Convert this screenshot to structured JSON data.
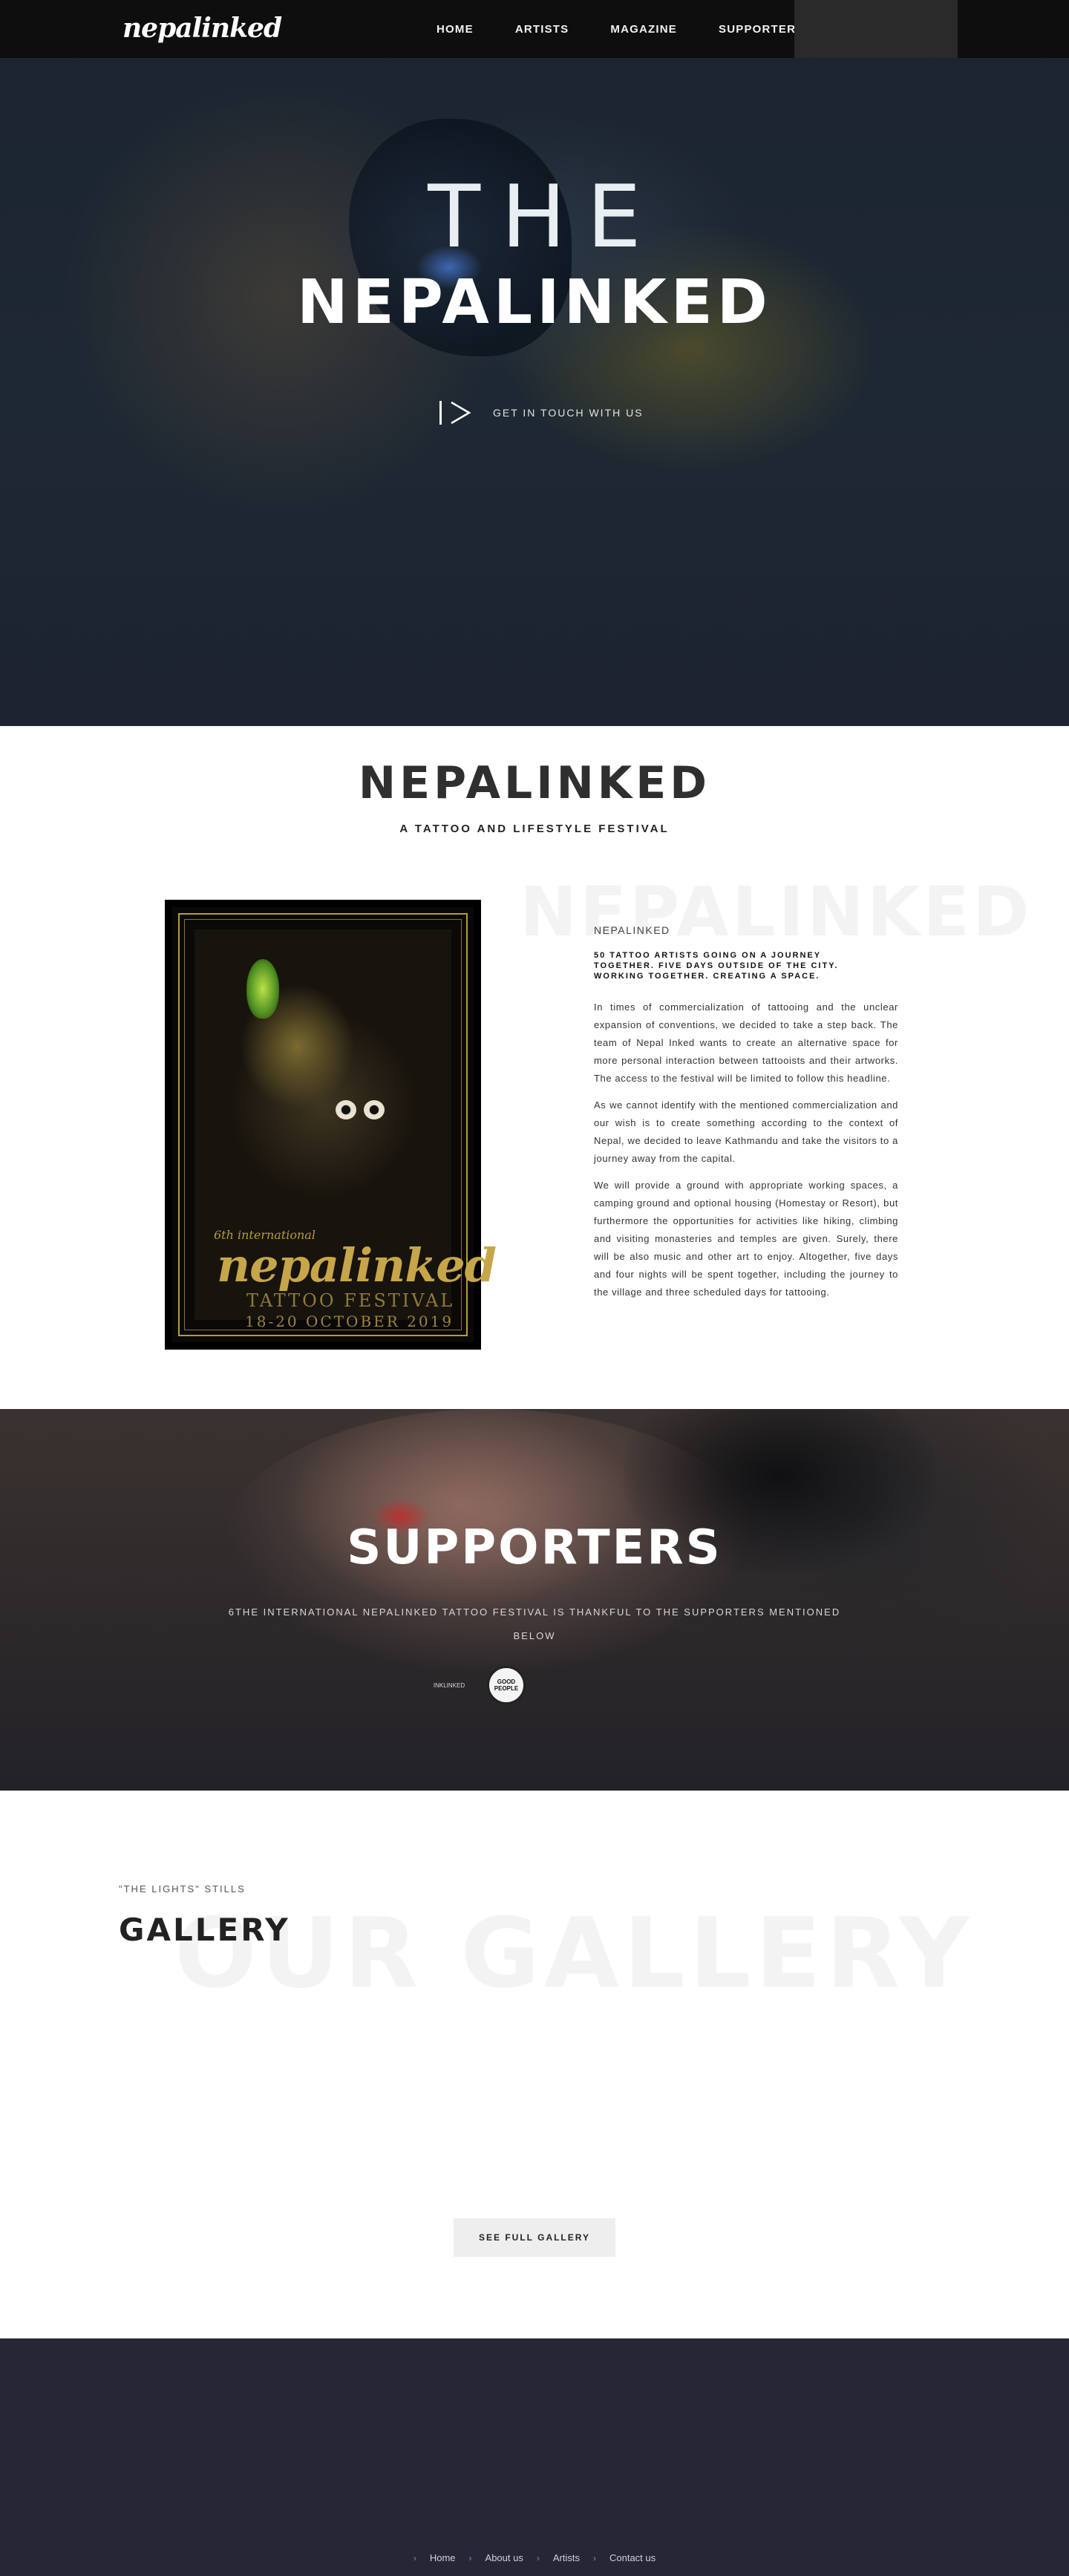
{
  "nav": {
    "logo_text": "nepalinked",
    "items": [
      {
        "label": "HOME"
      },
      {
        "label": "ARTISTS"
      },
      {
        "label": "MAGAZINE"
      },
      {
        "label": "SUPPORTERS"
      }
    ]
  },
  "hero": {
    "the": "THE",
    "title": "NEPALINKED",
    "cta_label": "GET IN TOUCH WITH US"
  },
  "about": {
    "title": "NEPALINKED",
    "subtitle": "A TATTOO AND LIFESTYLE FESTIVAL",
    "background_word": "NEPALINKED",
    "label": "NEPALINKED",
    "lead": "50 TATTOO ARTISTS GOING ON A JOURNEY TOGETHER. FIVE DAYS OUTSIDE OF THE CITY. WORKING TOGETHER. CREATING A SPACE.",
    "paragraphs": [
      "In times of commercialization of tattooing and the unclear expansion of conventions, we decided to take a step back. The team of Nepal Inked wants to create an alternative space for more personal interaction between tattooists and their artworks. The access to the festival will be limited to follow this headline.",
      "As we cannot identify with the mentioned commercialization and our wish is to create something according to the context of Nepal, we decided to leave Kathmandu and take the visitors to a journey away from the capital.",
      "We will provide a ground with appropriate working spaces, a camping ground and optional housing (Homestay or Resort), but furthermore the opportunities for activities like hiking, climbing and visiting monasteries and temples are given. Surely, there will be also music and other art to enjoy. Altogether, five days and four nights will be spent together, including the journey to the village and three scheduled days for tattooing."
    ],
    "poster": {
      "sub": "6th international",
      "brand": "nepalinked",
      "event": "TATTOO FESTIVAL",
      "date": "18-20 OCTOBER 2019"
    }
  },
  "supporters": {
    "title": "SUPPORTERS",
    "text": "6THE INTERNATIONAL NEPALINKED TATTOO FESTIVAL IS THANKFUL TO THE SUPPORTERS MENTIONED BELOW",
    "logos": [
      {
        "text": "INKLINKED"
      },
      {
        "text": "GOOD PEOPLE"
      }
    ]
  },
  "gallery": {
    "kicker": "\"THE LIGHTS\" STILLS",
    "title": "GALLERY",
    "background_word": "OUR GALLERY",
    "button_label": "SEE FULL GALLERY"
  },
  "footer": {
    "links": [
      {
        "label": "Home"
      },
      {
        "label": "About us"
      },
      {
        "label": "Artists"
      },
      {
        "label": "Contact us"
      }
    ]
  },
  "colors": {
    "nav_bg": "#0e0e0e",
    "footer_bg": "#272637",
    "accent_gold": "#b89a3a"
  }
}
